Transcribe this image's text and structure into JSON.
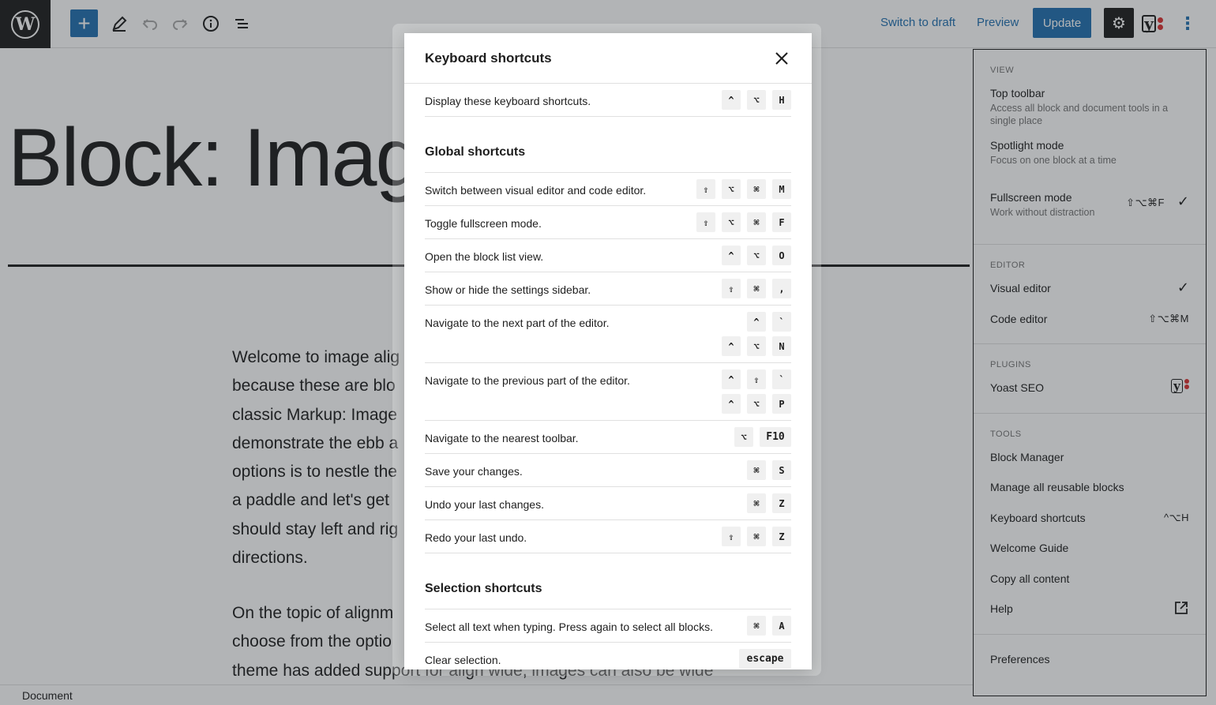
{
  "topbar": {
    "switch_draft": "Switch to draft",
    "preview": "Preview",
    "update": "Update"
  },
  "editor": {
    "title": "Block: Image",
    "p1_lines": [
      "Welcome to image alig",
      "because these are blo",
      "classic Markup: Image",
      "demonstrate the ebb a",
      "options is to nestle the",
      "a paddle and let's get",
      "should stay left and rig",
      "directions."
    ],
    "p2_lines": [
      "On the topic of alignm",
      "choose from the optio",
      "theme has added support for align wide, images can also be wide"
    ]
  },
  "statusbar": {
    "label": "Document"
  },
  "modal": {
    "title": "Keyboard shortcuts",
    "top_rows": [
      {
        "desc": "Display these keyboard shortcuts.",
        "combos": [
          [
            "^",
            "⌥",
            "H"
          ]
        ]
      }
    ],
    "sections": [
      {
        "title": "Global shortcuts",
        "rows": [
          {
            "desc": "Switch between visual editor and code editor.",
            "combos": [
              [
                "⇧",
                "⌥",
                "⌘",
                "M"
              ]
            ]
          },
          {
            "desc": "Toggle fullscreen mode.",
            "combos": [
              [
                "⇧",
                "⌥",
                "⌘",
                "F"
              ]
            ]
          },
          {
            "desc": "Open the block list view.",
            "combos": [
              [
                "^",
                "⌥",
                "O"
              ]
            ]
          },
          {
            "desc": "Show or hide the settings sidebar.",
            "combos": [
              [
                "⇧",
                "⌘",
                ","
              ]
            ]
          },
          {
            "desc": "Navigate to the next part of the editor.",
            "combos": [
              [
                "^",
                "`"
              ],
              [
                "^",
                "⌥",
                "N"
              ]
            ]
          },
          {
            "desc": "Navigate to the previous part of the editor.",
            "combos": [
              [
                "^",
                "⇧",
                "`"
              ],
              [
                "^",
                "⌥",
                "P"
              ]
            ]
          },
          {
            "desc": "Navigate to the nearest toolbar.",
            "combos": [
              [
                "⌥",
                "F10"
              ]
            ]
          },
          {
            "desc": "Save your changes.",
            "combos": [
              [
                "⌘",
                "S"
              ]
            ]
          },
          {
            "desc": "Undo your last changes.",
            "combos": [
              [
                "⌘",
                "Z"
              ]
            ]
          },
          {
            "desc": "Redo your last undo.",
            "combos": [
              [
                "⇧",
                "⌘",
                "Z"
              ]
            ]
          }
        ]
      },
      {
        "title": "Selection shortcuts",
        "rows": [
          {
            "desc": "Select all text when typing. Press again to select all blocks.",
            "combos": [
              [
                "⌘",
                "A"
              ]
            ]
          },
          {
            "desc": "Clear selection.",
            "combos": [
              [
                "escape"
              ]
            ]
          }
        ]
      }
    ]
  },
  "menu": {
    "groups": [
      {
        "label": "View",
        "items": [
          {
            "text": "Top toolbar",
            "desc": "Access all block and document tools in a single place",
            "shortcut": "",
            "check": ""
          },
          {
            "text": "Spotlight mode",
            "desc": "Focus on one block at a time",
            "shortcut": "",
            "check": ""
          },
          {
            "text": "Fullscreen mode",
            "desc": "Work without distraction",
            "shortcut": "⇧⌥⌘F",
            "check": "✓"
          }
        ]
      },
      {
        "label": "Editor",
        "items": [
          {
            "text": "Visual editor",
            "desc": "",
            "shortcut": "",
            "check": "✓"
          },
          {
            "text": "Code editor",
            "desc": "",
            "shortcut": "⇧⌥⌘M",
            "check": ""
          }
        ]
      },
      {
        "label": "Plugins",
        "items": [
          {
            "text": "Yoast SEO",
            "desc": "",
            "shortcut": "",
            "check": "",
            "icon": "yoast"
          }
        ]
      },
      {
        "label": "Tools",
        "items": [
          {
            "text": "Block Manager",
            "desc": "",
            "shortcut": "",
            "check": ""
          },
          {
            "text": "Manage all reusable blocks",
            "desc": "",
            "shortcut": "",
            "check": ""
          },
          {
            "text": "Keyboard shortcuts",
            "desc": "",
            "shortcut": "^⌥H",
            "check": ""
          },
          {
            "text": "Welcome Guide",
            "desc": "",
            "shortcut": "",
            "check": ""
          },
          {
            "text": "Copy all content",
            "desc": "",
            "shortcut": "",
            "check": ""
          },
          {
            "text": "Help",
            "desc": "",
            "shortcut": "",
            "check": "",
            "icon": "external"
          }
        ]
      },
      {
        "label": "",
        "items": [
          {
            "text": "Preferences",
            "desc": "",
            "shortcut": "",
            "check": ""
          }
        ]
      }
    ]
  },
  "colors": {
    "accent": "#2271b1",
    "dark": "#1e1e1e",
    "muted": "#757575",
    "kbd_bg": "#f0f0f0",
    "yoast_red": "#dc3232"
  }
}
